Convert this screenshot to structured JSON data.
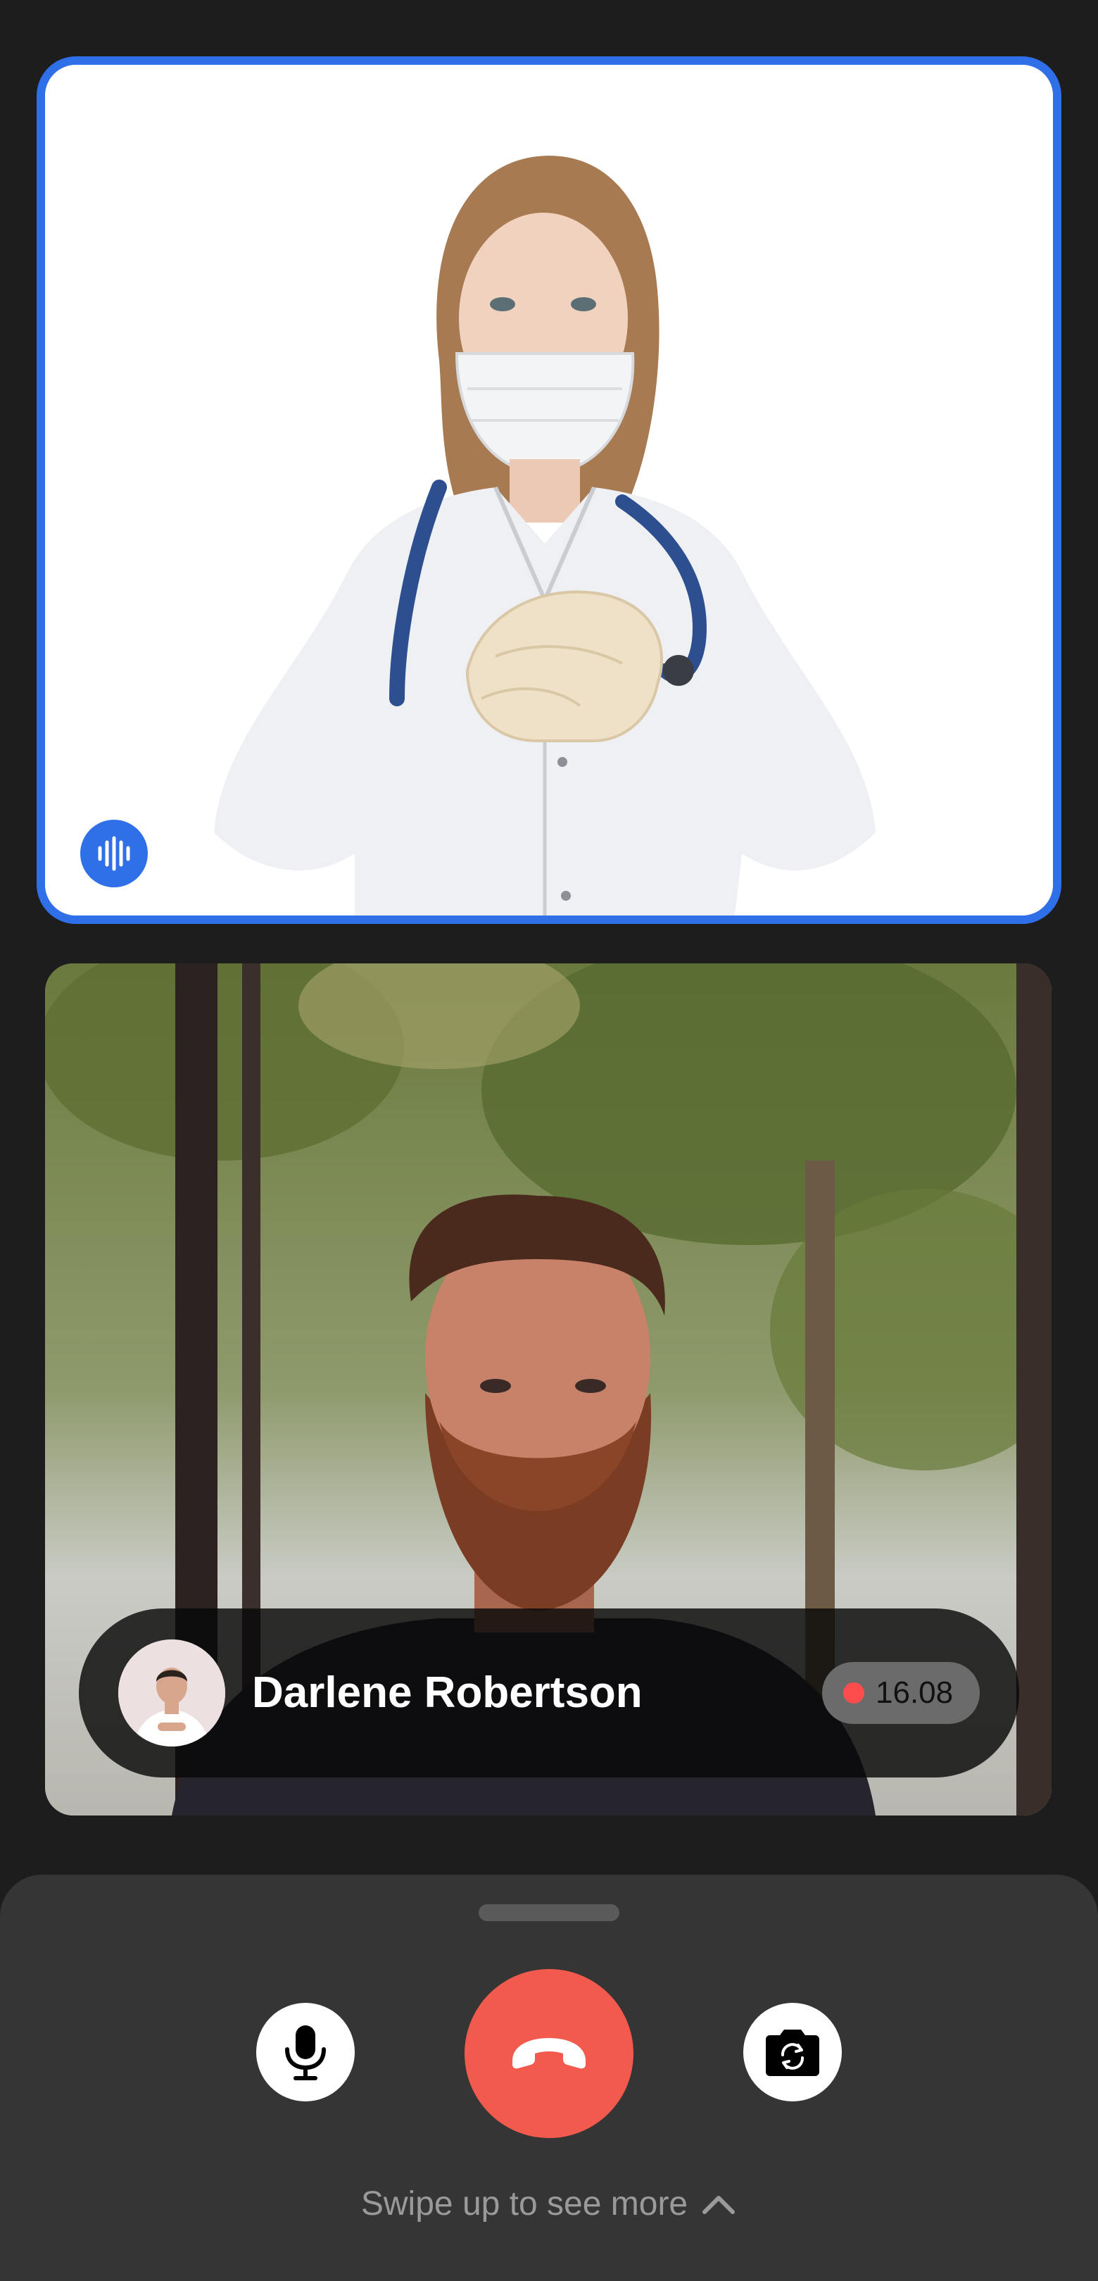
{
  "participants": {
    "active_speaker": {
      "voice_indicator_icon": "audio-waveform-icon",
      "highlight_color": "#2f6fe8"
    },
    "caller": {
      "name": "Darlene Robertson",
      "recording_time": "16.08",
      "recording_color": "#ff4d4d"
    }
  },
  "controls": {
    "mic_icon": "microphone-icon",
    "end_call_icon": "phone-hangup-icon",
    "end_call_color": "#f25a4e",
    "camera_icon": "camera-switch-icon"
  },
  "sheet": {
    "swipe_hint": "Swipe up to see more",
    "swipe_icon": "chevron-up-icon"
  }
}
